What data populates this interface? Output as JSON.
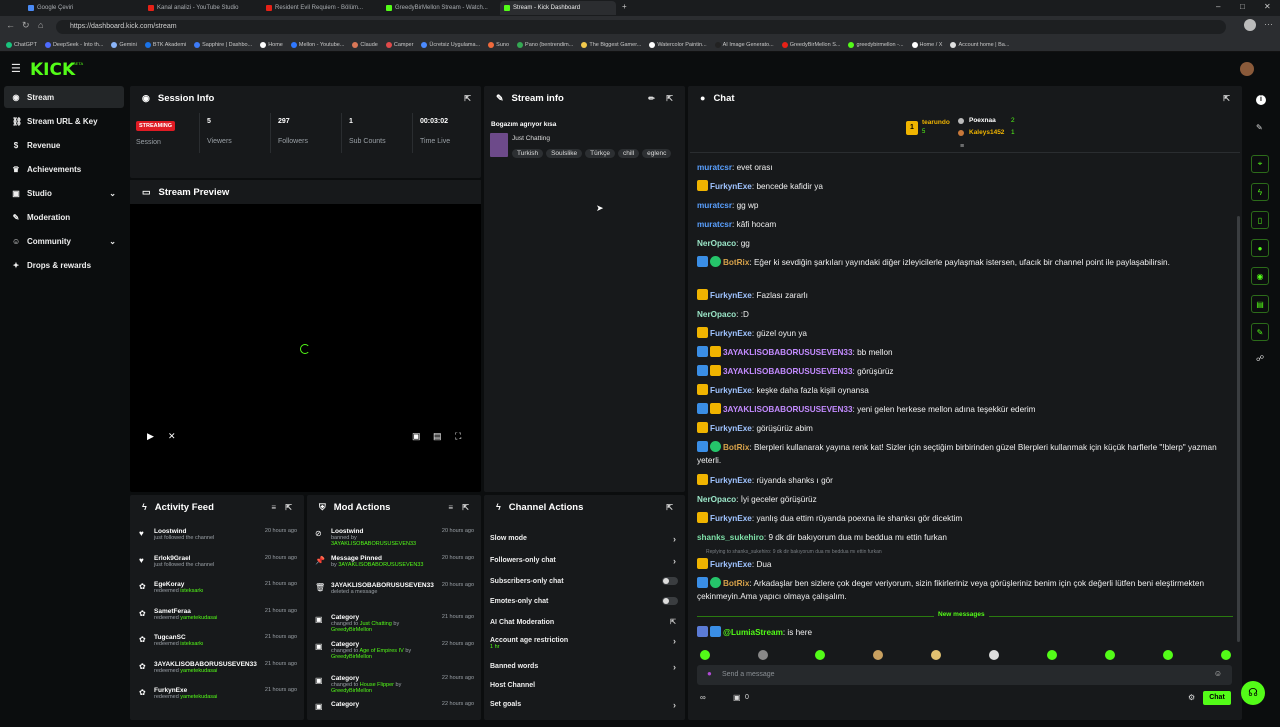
{
  "browser": {
    "tabs": [
      "Google Çeviri",
      "Kanal analizi - YouTube Studio",
      "Resident Evil Requiem - Bölüm...",
      "GreedyBirMellon Stream - Watch...",
      "Stream - Kick Dashboard"
    ],
    "url": "https://dashboard.kick.com/stream",
    "bookmarks": [
      "ChatGPT",
      "DeepSeek - Into th...",
      "Gemini",
      "BTK Akademi",
      "Sapphire | Dashbo...",
      "Home",
      "Mellon - Youtube...",
      "Claude",
      "Camper",
      "Ücretsiz Uygulama...",
      "Suno",
      "Pano (bentrendim...",
      "The Biggest Gamer...",
      "Watercolor Paintin...",
      "AI Image Generato...",
      "GreedyBirMellon S...",
      "greedybirmellon -...",
      "Home / X",
      "Account home | Ba..."
    ]
  },
  "brand": {
    "logo": "KICK",
    "beta": "BETA",
    "accent": "#53fc18"
  },
  "sidebar": {
    "items": [
      {
        "label": "Stream",
        "icon": "broadcast-icon"
      },
      {
        "label": "Stream URL & Key",
        "icon": "link-icon"
      },
      {
        "label": "Revenue",
        "icon": "dollar-icon"
      },
      {
        "label": "Achievements",
        "icon": "trophy-icon"
      },
      {
        "label": "Studio",
        "icon": "studio-icon"
      },
      {
        "label": "Moderation",
        "icon": "wrench-icon"
      },
      {
        "label": "Community",
        "icon": "community-icon"
      },
      {
        "label": "Drops & rewards",
        "icon": "gift-icon"
      }
    ]
  },
  "session": {
    "title": "Session Info",
    "status": "STREAMING",
    "status_label": "Session",
    "stats": [
      {
        "value": "5",
        "label": "Viewers"
      },
      {
        "value": "297",
        "label": "Followers"
      },
      {
        "value": "1",
        "label": "Sub Counts"
      },
      {
        "value": "00:03:02",
        "label": "Time Live"
      }
    ]
  },
  "preview": {
    "title": "Stream Preview"
  },
  "stream_info": {
    "title": "Stream info",
    "stream_title": "Bogazım agrıyor kısa",
    "category": "Just Chatting",
    "tags": [
      "Turkish",
      "Soulslike",
      "Türkçe",
      "chill",
      "eglenc"
    ]
  },
  "activity": {
    "title": "Activity Feed",
    "items": [
      {
        "name": "Loostwind",
        "sub": "just followed the channel",
        "green": "",
        "time": "20 hours ago"
      },
      {
        "name": "Erlok9Grael",
        "sub": "just followed the channel",
        "green": "",
        "time": "20 hours ago"
      },
      {
        "name": "EgeKoray",
        "sub": "redeemed ",
        "green": "isteksarkı",
        "time": "21 hours ago"
      },
      {
        "name": "SametFeraa",
        "sub": "redeemed ",
        "green": "yametekudasai",
        "time": "21 hours ago"
      },
      {
        "name": "TugcanSC",
        "sub": "redeemed ",
        "green": "isteksarkı",
        "time": "21 hours ago"
      },
      {
        "name": "3AYAKLISOBABORUSUSEVEN33",
        "sub": "redeemed ",
        "green": "yametekudasai",
        "time": "21 hours ago"
      },
      {
        "name": "FurkynExe",
        "sub": "redeemed ",
        "green": "yametekudasai",
        "time": "21 hours ago"
      }
    ]
  },
  "mod_actions": {
    "title": "Mod Actions",
    "items": [
      {
        "name": "Loostwind",
        "sub": "banned by ",
        "green": "3AYAKLISOBABORUSUSEVEN33",
        "time": "20 hours ago"
      },
      {
        "name": "Message Pinned",
        "sub": "by ",
        "green": "3AYAKLISOBABORUSUSEVEN33",
        "time": "20 hours ago"
      },
      {
        "name": "3AYAKLISOBABORUSUSEVEN33",
        "sub": "deleted a message",
        "green": "",
        "time": "20 hours ago"
      },
      {
        "name": "Category",
        "sub": "changed to ",
        "green": "Just Chatting",
        "time": "21 hours ago"
      },
      {
        "name": "Category",
        "sub": "changed to ",
        "green": "Age of Empires IV",
        "time": "22 hours ago"
      },
      {
        "name": "Category",
        "sub": "changed to ",
        "green": "House Flipper",
        "time": "22 hours ago"
      },
      {
        "name": "Category",
        "sub": "",
        "green": "",
        "time": "22 hours ago"
      }
    ],
    "by_user": "GreedyBirMellon",
    "by_word": "by"
  },
  "channel_actions": {
    "title": "Channel Actions",
    "items": [
      {
        "label": "Slow mode",
        "kind": "arrow"
      },
      {
        "label": "Followers-only chat",
        "kind": "arrow"
      },
      {
        "label": "Subscribers-only chat",
        "kind": "toggle"
      },
      {
        "label": "Emotes-only chat",
        "kind": "toggle"
      },
      {
        "label": "AI Chat Moderation",
        "kind": "link"
      },
      {
        "label": "Account age restriction",
        "kind": "arrow"
      },
      {
        "label": "Banned words",
        "kind": "arrow"
      },
      {
        "label": "Host Channel",
        "kind": "none"
      },
      {
        "label": "Set goals",
        "kind": "arrow"
      }
    ],
    "age_value": "1 hr"
  },
  "chat": {
    "title": "Chat",
    "leaderboard": [
      {
        "name": "tearundo",
        "count": "5"
      },
      {
        "name": "Poexnaa",
        "count": "2"
      },
      {
        "name": "Kaleys1452",
        "count": "1"
      }
    ],
    "messages": [
      {
        "user": "muratcsr",
        "color": "#5aa0ff",
        "badges": [],
        "text": "evet orası"
      },
      {
        "user": "FurkynExe",
        "color": "#9fc3ff",
        "badges": [
          "crown"
        ],
        "text": "bencede kafidir ya"
      },
      {
        "user": "muratcsr",
        "color": "#5aa0ff",
        "badges": [],
        "text": "gg wp"
      },
      {
        "user": "muratcsr",
        "color": "#5aa0ff",
        "badges": [],
        "text": "kâfi hocam"
      },
      {
        "user": "NerOpaco",
        "color": "#9be6c8",
        "badges": [],
        "text": "gg"
      },
      {
        "user": "BotRix",
        "color": "#d6a14a",
        "badges": [
          "mod",
          "ver"
        ],
        "text": "Eğer ki sevdiğin şarkıları yayındaki diğer izleyicilerle paylaşmak istersen, ufacık bir channel point ile paylaşabilirsin."
      },
      {
        "user": "FurkynExe",
        "color": "#9fc3ff",
        "badges": [
          "crown"
        ],
        "text": "Fazlası zararlı"
      },
      {
        "user": "NerOpaco",
        "color": "#9be6c8",
        "badges": [],
        "text": ":D"
      },
      {
        "user": "FurkynExe",
        "color": "#9fc3ff",
        "badges": [
          "crown"
        ],
        "text": "güzel oyun ya"
      },
      {
        "user": "3AYAKLISOBABORUSUSEVEN33",
        "color": "#c38bff",
        "badges": [
          "mod",
          "crown"
        ],
        "text": "bb mellon"
      },
      {
        "user": "3AYAKLISOBABORUSUSEVEN33",
        "color": "#c38bff",
        "badges": [
          "mod",
          "crown"
        ],
        "text": "görüşürüz"
      },
      {
        "user": "FurkynExe",
        "color": "#9fc3ff",
        "badges": [
          "crown"
        ],
        "text": "keşke daha fazla kişili oynansa"
      },
      {
        "user": "3AYAKLISOBABORUSUSEVEN33",
        "color": "#c38bff",
        "badges": [
          "mod",
          "crown"
        ],
        "text": "yeni gelen herkese mellon adına teşekkür ederim"
      },
      {
        "user": "FurkynExe",
        "color": "#9fc3ff",
        "badges": [
          "crown"
        ],
        "text": "görüşürüz abim"
      },
      {
        "user": "BotRix",
        "color": "#d6a14a",
        "badges": [
          "mod",
          "ver"
        ],
        "text": "Blerpleri kullanarak yayına renk kat! Sizler için seçtiğim birbirinden güzel Blerpleri kullanmak için küçük harflerle \"!blerp\" yazman yeterli."
      },
      {
        "user": "FurkynExe",
        "color": "#9fc3ff",
        "badges": [
          "crown"
        ],
        "text": "rüyanda shanks ı gör"
      },
      {
        "user": "NerOpaco",
        "color": "#9be6c8",
        "badges": [],
        "text": "İyi geceler görüşürüz"
      },
      {
        "user": "FurkynExe",
        "color": "#9fc3ff",
        "badges": [
          "crown"
        ],
        "text": "yanlış dua ettim rüyanda poexna ile shanksı gör dicektim"
      },
      {
        "user": "shanks_sukehiro",
        "color": "#7ee0a8",
        "badges": [],
        "text": "9 dk dir bakıyorum dua mı beddua mı ettin furkan"
      },
      {
        "user": "FurkynExe",
        "color": "#9fc3ff",
        "badges": [
          "crown"
        ],
        "text": "Dua"
      },
      {
        "user": "BotRix",
        "color": "#d6a14a",
        "badges": [
          "mod",
          "ver"
        ],
        "text": "Arkadaşlar ben sizlere çok deger veriyorum, sizin fikirleriniz veya görüşleriniz benim için çok değerli lütfen beni eleştirmekten çekinmeyin.Ama yapıcı olmaya çalışalım."
      }
    ],
    "reply_note": "Replying to shanks_sukehiro: 9 dk dir bakıyorum dua mı beddua mı ettin furkan",
    "new_messages": "New messages",
    "last": {
      "user": "@LumiaStream",
      "text": "is here"
    },
    "placeholder": "Send a message",
    "viewer_count": "0",
    "send": "Chat"
  }
}
